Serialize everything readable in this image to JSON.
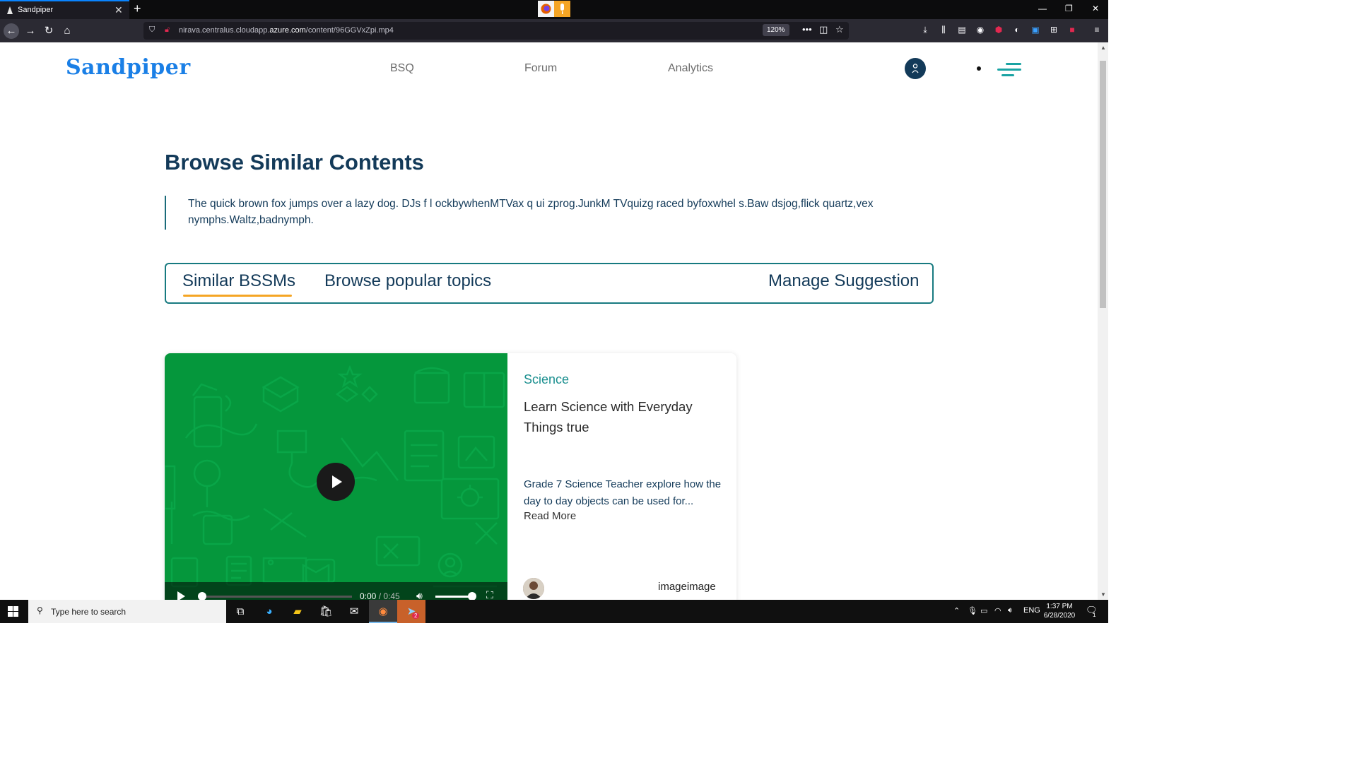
{
  "browser": {
    "tab_title": "Sandpiper",
    "url_prefix": "nirava.centralus.cloudapp.",
    "url_domain": "azure.com",
    "url_path": "/content/96GGVxZpi.mp4",
    "zoom": "120%"
  },
  "site": {
    "logo": "Sandpiper",
    "nav": [
      "BSQ",
      "Forum",
      "Analytics"
    ]
  },
  "main": {
    "heading": "Browse Similar Contents",
    "description": "The quick brown fox jumps over a lazy dog. DJs f l ockbywhenMTVax q ui zprog.JunkM TVquizg raced byfoxwhel s.Baw dsjog,flick quartz,vex nymphs.Waltz,badnymph.",
    "tabs": [
      "Similar BSSMs",
      "Browse popular topics",
      "Manage Suggestion"
    ],
    "active_tab": "Similar BSSMs"
  },
  "card": {
    "subject": "Science",
    "title": "Learn Science with Everyday Things true",
    "description": "Grade 7 Science Teacher explore how the day to day objects can be used for...",
    "read_more": "Read More",
    "author": "imageimage",
    "video": {
      "current_time": "0:00",
      "duration": "/ 0:45",
      "progress": 0.0,
      "volume": 1.0
    }
  },
  "taskbar": {
    "search_placeholder": "Type here to search",
    "language": "ENG",
    "time": "1:37 PM",
    "date": "6/28/2020",
    "notification_count": "1",
    "telegram_badge": "2"
  },
  "colors": {
    "brand_blue": "#1a7fe6",
    "navy": "#133a59",
    "teal": "#177a80",
    "accent_orange": "#f5a524",
    "video_green": "#05973c"
  }
}
